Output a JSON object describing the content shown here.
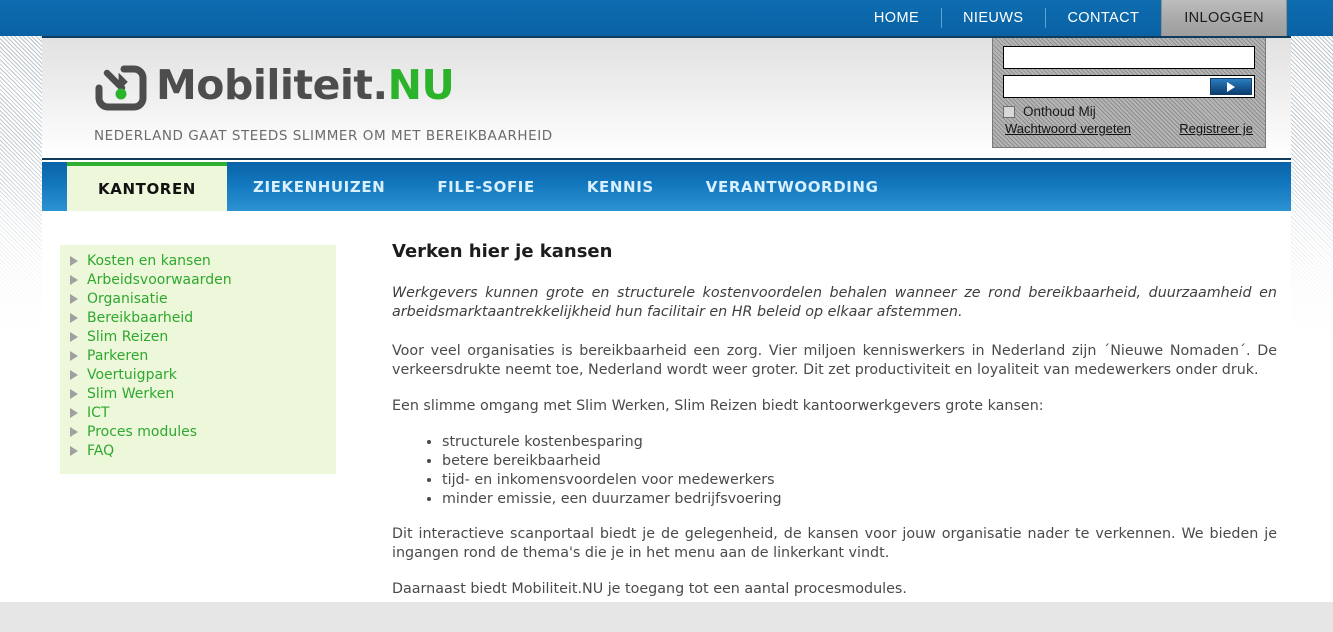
{
  "topnav": {
    "items": [
      {
        "label": "HOME",
        "active": false
      },
      {
        "label": "NIEUWS",
        "active": false
      },
      {
        "label": "CONTACT",
        "active": false
      },
      {
        "label": "INLOGGEN",
        "active": true
      }
    ]
  },
  "brand": {
    "name_main": "Mobiliteit.",
    "name_accent": "NU",
    "tagline": "NEDERLAND GAAT STEEDS SLIMMER OM MET BEREIKBAARHEID",
    "logo_icon": "arrow-into-box-icon",
    "accent_color": "#2bb32b",
    "text_color": "#4d4d4d"
  },
  "login": {
    "username_value": "",
    "username_placeholder": "",
    "password_value": "",
    "password_placeholder": "",
    "submit_icon": "play-arrow-icon",
    "remember_label": "Onthoud Mij",
    "remember_checked": false,
    "forgot_password_link": "Wachtwoord vergeten",
    "register_link": "Registreer je"
  },
  "mainnav": {
    "items": [
      {
        "label": "KANTOREN",
        "active": true
      },
      {
        "label": "ZIEKENHUIZEN",
        "active": false
      },
      {
        "label": "FILE-SOFIE",
        "active": false
      },
      {
        "label": "KENNIS",
        "active": false
      },
      {
        "label": "VERANTWOORDING",
        "active": false
      }
    ],
    "active_bg": "#edf7d9",
    "active_top_border": "#2fae2f"
  },
  "sidebar": {
    "items": [
      {
        "label": "Kosten en kansen"
      },
      {
        "label": "Arbeidsvoorwaarden"
      },
      {
        "label": "Organisatie"
      },
      {
        "label": "Bereikbaarheid"
      },
      {
        "label": "Slim Reizen"
      },
      {
        "label": "Parkeren"
      },
      {
        "label": "Voertuigpark"
      },
      {
        "label": "Slim Werken"
      },
      {
        "label": "ICT"
      },
      {
        "label": "Proces modules"
      },
      {
        "label": "FAQ"
      }
    ],
    "bullet_icon": "triangle-right-icon",
    "link_color": "#2fa82f",
    "background": "#edf7d9"
  },
  "article": {
    "title": "Verken hier je kansen",
    "lede": "Werkgevers kunnen grote en structurele kostenvoordelen behalen wanneer ze rond bereikbaarheid, duurzaamheid en arbeidsmarktaantrekkelijkheid hun facilitair en HR beleid op elkaar afstemmen.",
    "paragraph_1": "Voor veel organisaties is bereikbaarheid een zorg. Vier miljoen kenniswerkers in Nederland zijn ´Nieuwe Nomaden´. De verkeersdrukte neemt toe, Nederland wordt weer groter. Dit zet productiviteit en loyaliteit van medewerkers onder druk.",
    "paragraph_2": "Een slimme omgang met Slim Werken, Slim Reizen biedt kantoorwerkgevers grote kansen:",
    "bullets": [
      "structurele kostenbesparing",
      "betere bereikbaarheid",
      "tijd- en inkomensvoordelen voor medewerkers",
      "minder emissie, een duurzamer bedrijfsvoering"
    ],
    "paragraph_3": "Dit interactieve scanportaal biedt je de gelegenheid, de kansen voor jouw organisatie nader te verkennen. We bieden je ingangen rond de thema's die je in het menu aan de linkerkant vindt.",
    "paragraph_4": "Daarnaast biedt Mobiliteit.NU je toegang tot een aantal procesmodules."
  }
}
